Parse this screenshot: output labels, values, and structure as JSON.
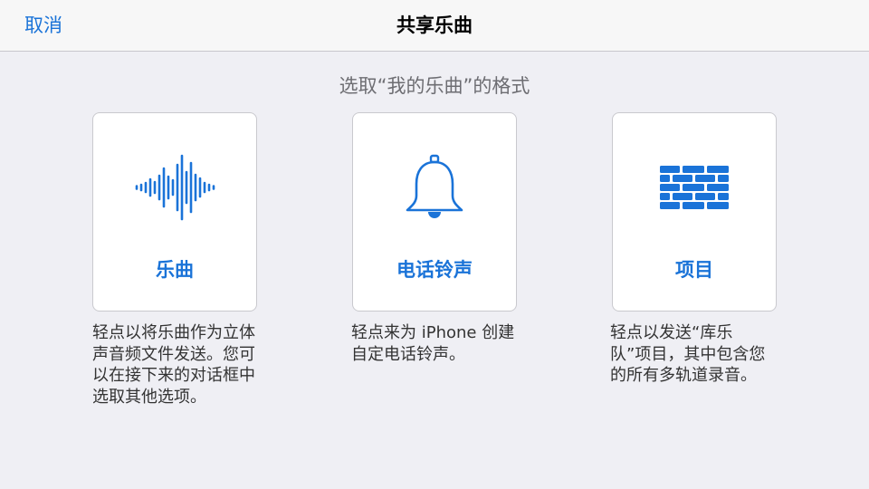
{
  "header": {
    "cancel_label": "取消",
    "title": "共享乐曲"
  },
  "subtitle": "选取“我的乐曲”的格式",
  "options": [
    {
      "label": "乐曲",
      "icon": "waveform-icon",
      "description_lines": [
        "轻点以将乐曲作为立体",
        "声音频文件发送。您可",
        "以在接下来的对话框中",
        "选取其他选项。"
      ]
    },
    {
      "label": "电话铃声",
      "icon": "bell-icon",
      "description_lines": [
        "轻点来为 iPhone 创建",
        "自定电话铃声。"
      ]
    },
    {
      "label": "项目",
      "icon": "brick-wall-icon",
      "description_lines": [
        "轻点以发送“库乐",
        "队”项目，其中包含您",
        "的所有多轨道录音。"
      ]
    }
  ],
  "colors": {
    "accent": "#1a73d8",
    "background": "#efeff4",
    "header_background": "#f7f7f7",
    "card_background": "#ffffff",
    "subtitle": "#6d6d72",
    "description": "#333333"
  }
}
